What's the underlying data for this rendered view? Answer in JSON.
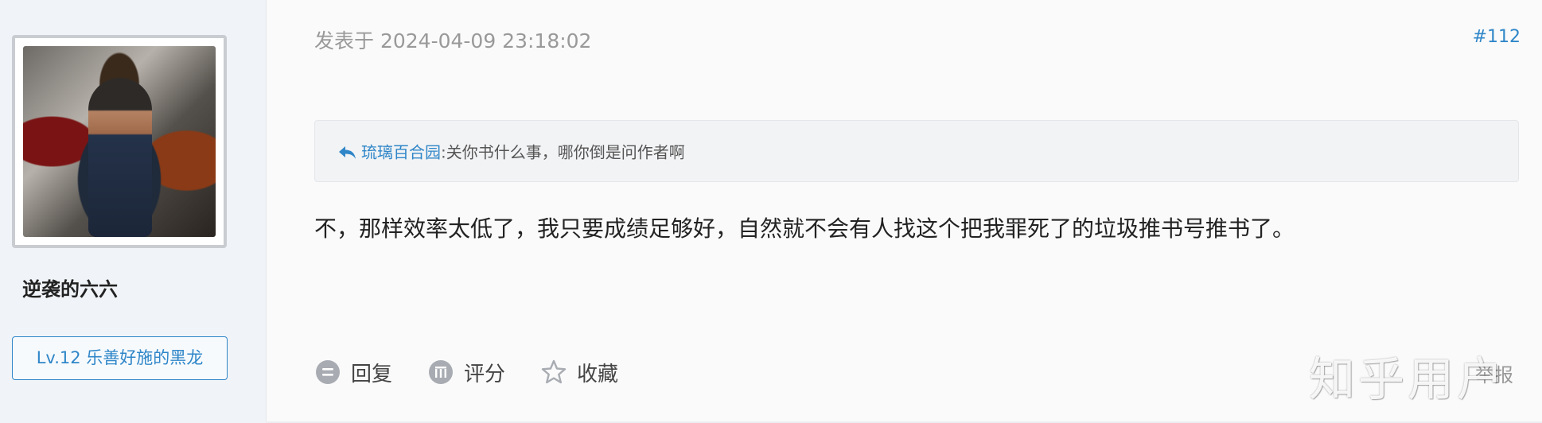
{
  "user": {
    "name": "逆袭的六六",
    "level_badge": "Lv.12 乐善好施的黑龙"
  },
  "post": {
    "meta": "发表于 2024-04-09 23:18:02",
    "floor": "#112",
    "quote": {
      "author": "琉璃百合园",
      "separator": ":",
      "text": "关你书什么事，哪你倒是问作者啊"
    },
    "body": "不，那样效率太低了，我只要成绩足够好，自然就不会有人找这个把我罪死了的垃圾推书号推书了。"
  },
  "actions": {
    "reply_label": "回复",
    "rate_label": "评分",
    "favorite_label": "收藏",
    "report_label": "举报"
  },
  "watermark": "知乎用户",
  "colors": {
    "accent": "#2f86c8",
    "muted": "#999999",
    "sidebar_bg": "#f0f3f7"
  }
}
